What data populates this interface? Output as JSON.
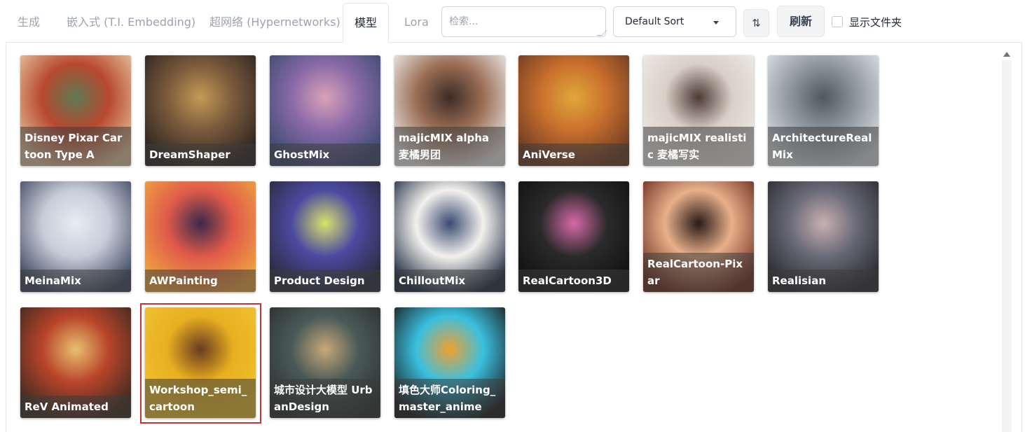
{
  "tabs": [
    {
      "label": "生成"
    },
    {
      "label": "嵌入式 (T.I. Embedding)"
    },
    {
      "label": "超网络 (Hypernetworks)"
    },
    {
      "label": "模型"
    },
    {
      "label": "Lora"
    }
  ],
  "active_tab": "模型",
  "search": {
    "placeholder": "检索...",
    "value": ""
  },
  "sort": {
    "selected": "Default Sort"
  },
  "sort_direction_icon": "⇅",
  "refresh_label": "刷新",
  "show_folders": {
    "label": "显示文件夹",
    "checked": false
  },
  "models": [
    {
      "name": "Disney Pixar Cartoon Type A",
      "colors": [
        "#e9c9a2",
        "#b7482f",
        "#5e7a52"
      ]
    },
    {
      "name": "DreamShaper",
      "colors": [
        "#2a2320",
        "#7a5a3c",
        "#c49a55"
      ]
    },
    {
      "name": "GhostMix",
      "colors": [
        "#3a4a6e",
        "#8a6aa8",
        "#d9a2b8"
      ]
    },
    {
      "name": "majicMIX alpha 麦橘男团",
      "colors": [
        "#f0efee",
        "#9a6e55",
        "#3c2b24"
      ]
    },
    {
      "name": "AniVerse",
      "colors": [
        "#6b3a22",
        "#c9702d",
        "#e0a73a"
      ]
    },
    {
      "name": "majicMIX realistic 麦橘写实",
      "colors": [
        "#efece8",
        "#d9cfc6",
        "#4a3a33"
      ]
    },
    {
      "name": "ArchitectureRealMix",
      "colors": [
        "#dfe3e6",
        "#8e979e",
        "#4f5860"
      ]
    },
    {
      "name": "MeinaMix",
      "colors": [
        "#3e4860",
        "#c8ccd8",
        "#e8ecf2"
      ]
    },
    {
      "name": "AWPainting",
      "colors": [
        "#f0a640",
        "#e05a4a",
        "#3a2a4a"
      ]
    },
    {
      "name": "Product Design",
      "colors": [
        "#2a2a3a",
        "#4b4aa0",
        "#d8e26a"
      ]
    },
    {
      "name": "ChilloutMix",
      "colors": [
        "#1c2a40",
        "#f3f1ee",
        "#3a4a70"
      ]
    },
    {
      "name": "RealCartoon3D",
      "colors": [
        "#111111",
        "#2a2a2a",
        "#d86aa8"
      ]
    },
    {
      "name": "RealCartoon-Pixar",
      "colors": [
        "#6a2a1e",
        "#e8b08a",
        "#2a1a18"
      ]
    },
    {
      "name": "Realisian",
      "colors": [
        "#2a2a30",
        "#6a6a78",
        "#c8b0b0"
      ]
    },
    {
      "name": "ReV Animated",
      "colors": [
        "#3a2a20",
        "#b8442a",
        "#e8c070"
      ]
    },
    {
      "name": "Workshop_semi_cartoon",
      "colors": [
        "#f1c232",
        "#e8b020",
        "#6a3a20"
      ]
    },
    {
      "name": "城市设计大模型 UrbanDesign",
      "colors": [
        "#2a3030",
        "#4a5a58",
        "#c8a878"
      ]
    },
    {
      "name": "填色大师Coloring_master_anime",
      "colors": [
        "#1a1a1a",
        "#3ac0e0",
        "#f0a030"
      ]
    }
  ],
  "highlighted_model": "Workshop_semi_cartoon"
}
